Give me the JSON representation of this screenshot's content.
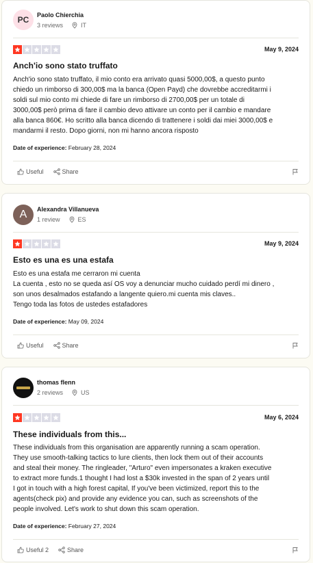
{
  "colors": {
    "star_on": "#ff3722",
    "star_off": "#dcdce6",
    "page_bg": "#fcfbf3"
  },
  "reviews": [
    {
      "avatar_initials": "PC",
      "reviewer": "Paolo Chierchia",
      "review_count": "3 reviews",
      "country": "IT",
      "rating": 1,
      "date": "May 9, 2024",
      "title": "Anch'io sono stato truffato",
      "body": "Anch'io sono stato truffato, il mio conto era arrivato quasi 5000,00$, a questo punto\nchiedo un rimborso di 300,00$ ma la banca (Open Payd) che dovrebbe accreditarmi i\nsoldi sul mio conto mi chiede di fare un rimborso di 2700,00$ per un totale di\n3000,00$ però prima di fare il cambio devo attivare un conto per il cambio e mandare\nalla banca 860€. Ho scritto alla banca dicendo di trattenere i soldi dai miei 3000,00$ e\nmandarmi il resto. Dopo giorni, non mi hanno ancora risposto",
      "doe_label": "Date of experience:",
      "doe_value": "February 28, 2024",
      "useful_label": "Useful",
      "share_label": "Share"
    },
    {
      "avatar_initials": "A",
      "reviewer": "Alexandra Villanueva",
      "review_count": "1 review",
      "country": "ES",
      "rating": 1,
      "date": "May 9, 2024",
      "title": "Esto es una es una estafa",
      "body": "Esto es una estafa me cerraron mi cuenta\nLa cuenta , esto no se queda así OS voy a denunciar mucho cuidado perdí mi dinero ,\nson unos desalmados estafando a langente quiero.mi cuenta mis claves..\nTengo toda las fotos de ustedes estafadores",
      "doe_label": "Date of experience:",
      "doe_value": "May 09, 2024",
      "useful_label": "Useful",
      "share_label": "Share"
    },
    {
      "avatar_initials": "",
      "reviewer": "thomas flenn",
      "review_count": "2 reviews",
      "country": "US",
      "rating": 1,
      "date": "May 6, 2024",
      "title": "These individuals from this...",
      "body": "These individuals from this organisation are apparently running a scam operation.\nThey use smooth-talking tactics to lure clients, then lock them out of their accounts\nand steal their money. The ringleader, \"Arturo\" even impersonates a kraken executive\nto extract more funds.1 thought I had lost a $30k invested in the span of 2 years until\nI got in touch with a high forest capital, If you've been victimized, report this to the\nagents(check pix) and provide any evidence you can, such as screenshots of the\npeople involved. Let's work to shut down this scam operation.",
      "doe_label": "Date of experience:",
      "doe_value": "February 27, 2024",
      "useful_label": "Useful 2",
      "share_label": "Share"
    }
  ]
}
